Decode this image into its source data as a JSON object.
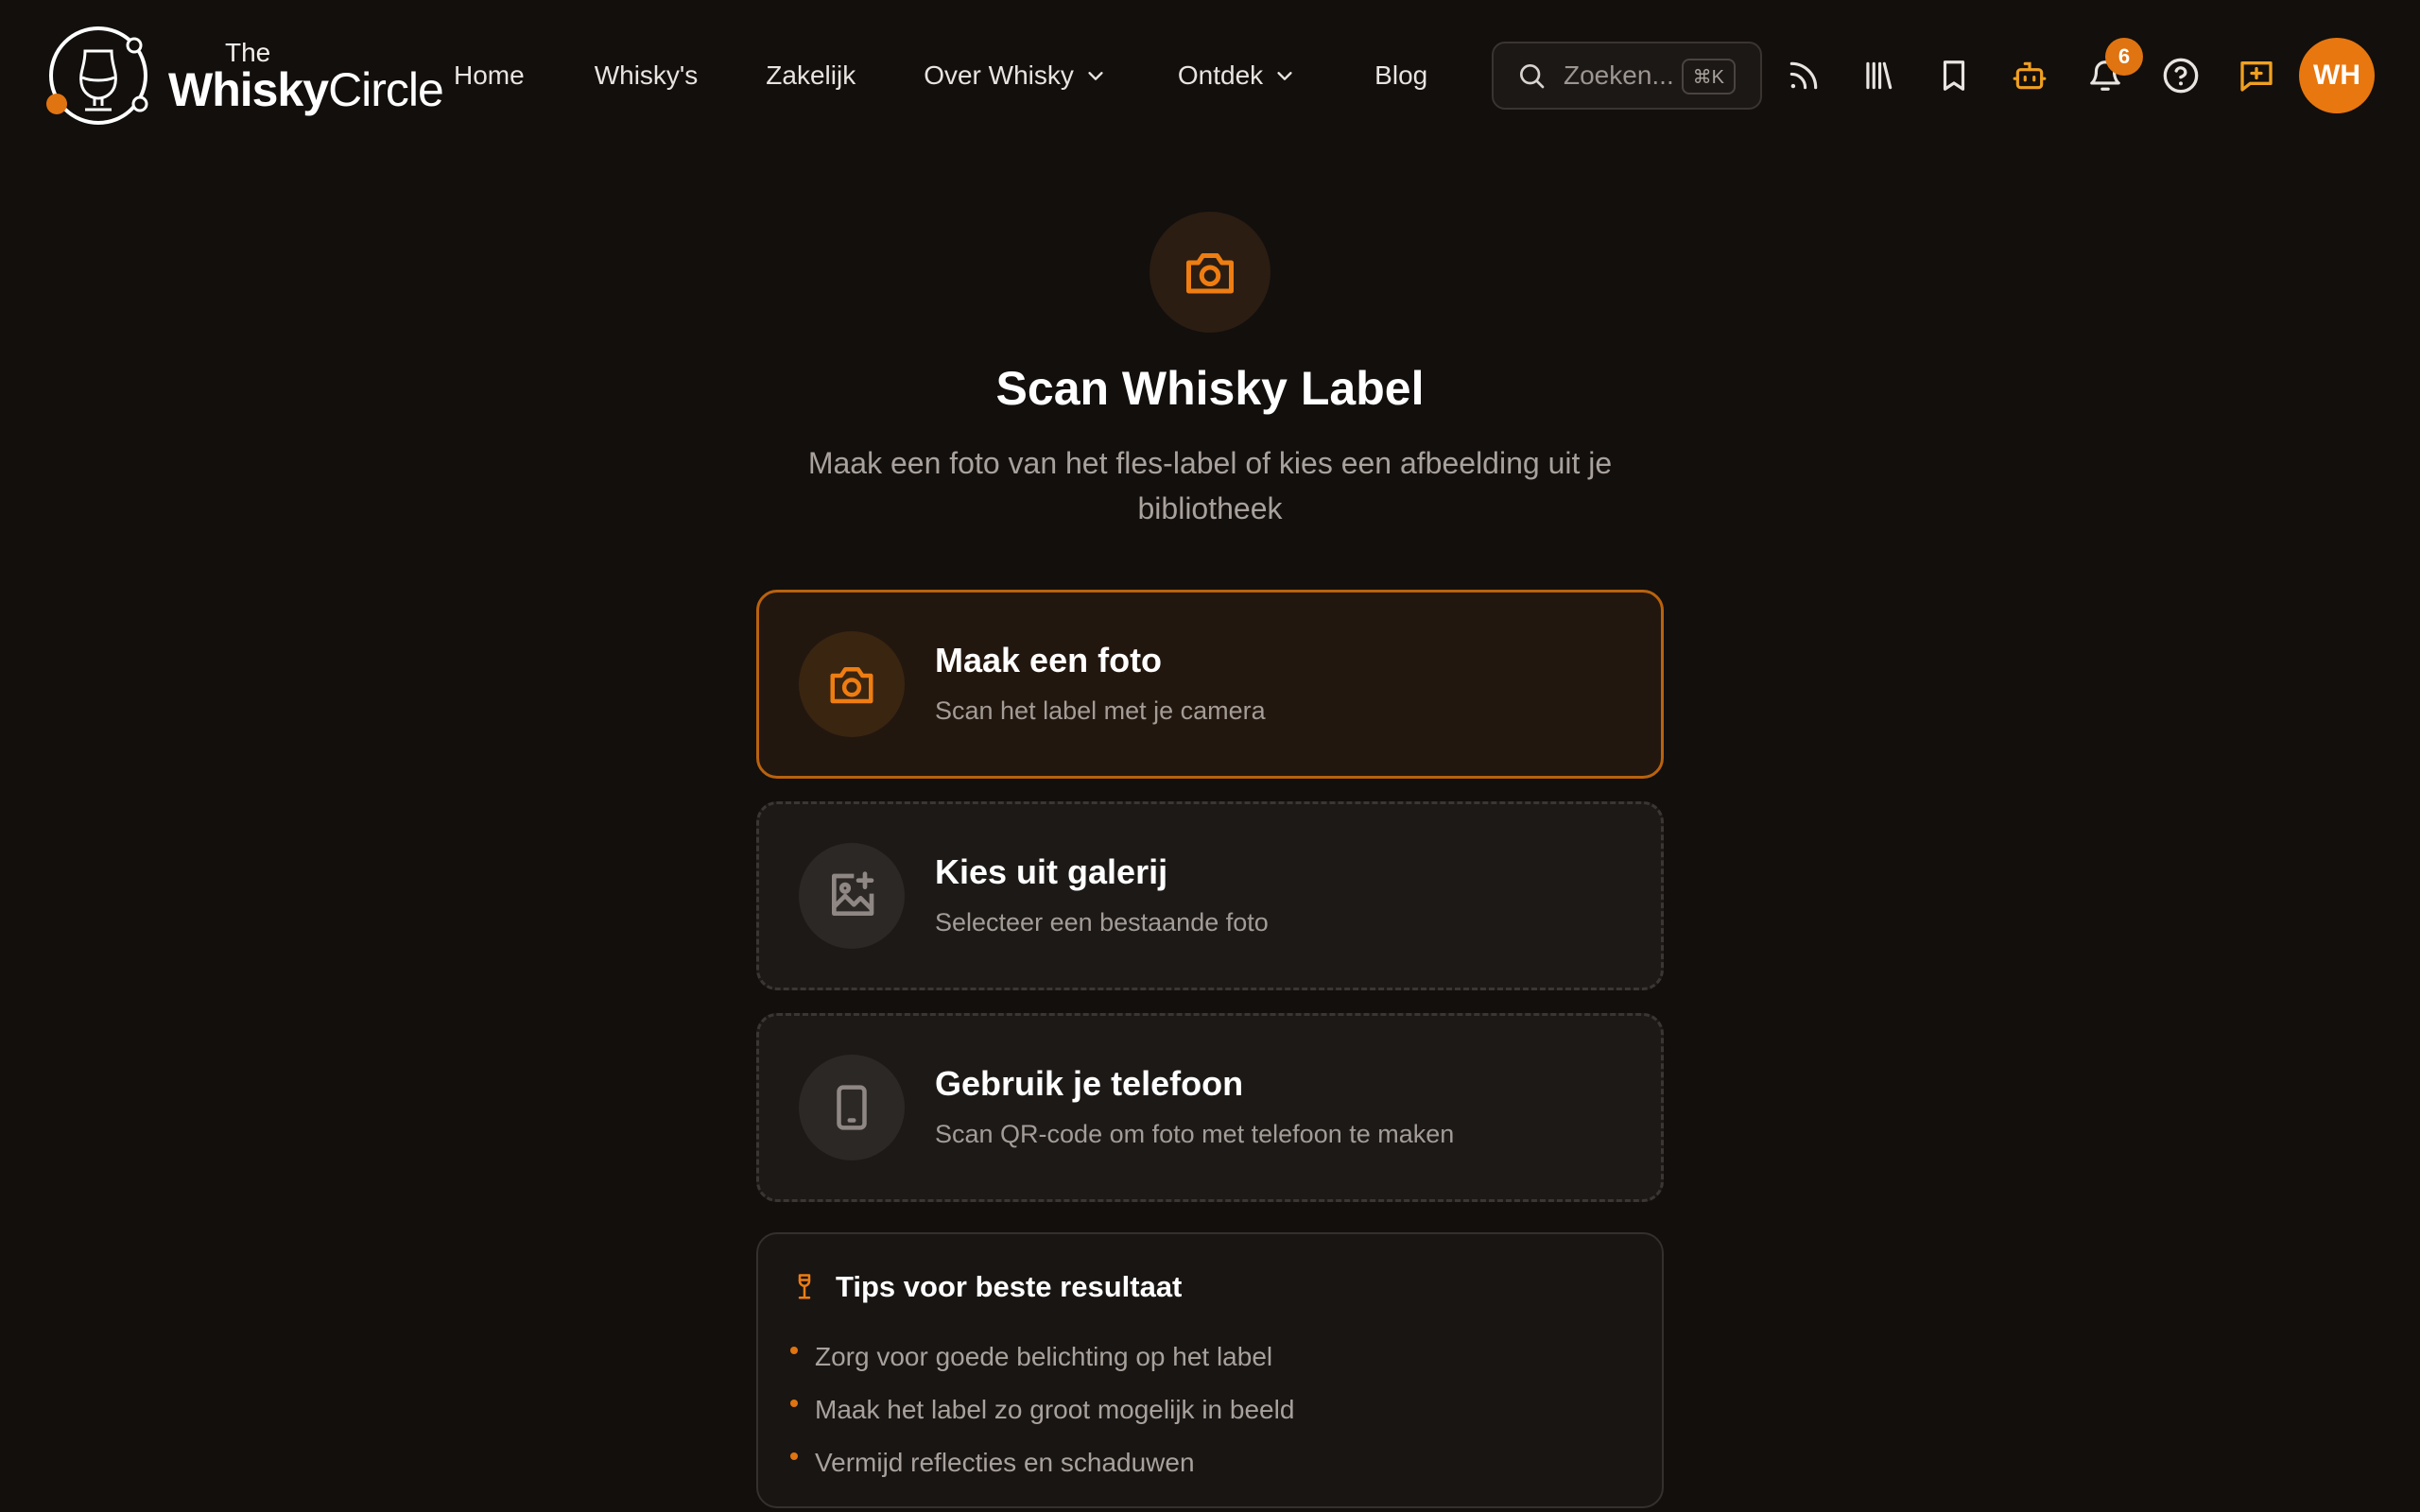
{
  "brand": {
    "the": "The",
    "name_bold": "Whisky",
    "name_regular": "Circle",
    "accent": "#e07411"
  },
  "nav": {
    "links": [
      {
        "label": "Home",
        "dropdown": false
      },
      {
        "label": "Whisky's",
        "dropdown": false
      },
      {
        "label": "Zakelijk",
        "dropdown": false
      },
      {
        "label": "Over Whisky",
        "dropdown": true
      },
      {
        "label": "Ontdek",
        "dropdown": true
      },
      {
        "label": "Blog",
        "dropdown": false
      }
    ],
    "search": {
      "placeholder": "Zoeken...",
      "shortcut": "⌘K"
    },
    "icons": [
      "rss-icon",
      "library-icon",
      "bookmark-icon",
      "bot-icon",
      "bell-icon",
      "help-icon",
      "message-plus-icon"
    ],
    "notifications_count": "6",
    "avatar_initials": "WH"
  },
  "main": {
    "title": "Scan Whisky Label",
    "subtitle": "Maak een foto van het fles-label of kies een afbeelding uit je bibliotheek",
    "options": [
      {
        "title": "Maak een foto",
        "description": "Scan het label met je camera",
        "icon": "camera-icon"
      },
      {
        "title": "Kies uit galerij",
        "description": "Selecteer een bestaande foto",
        "icon": "image-plus-icon"
      },
      {
        "title": "Gebruik je telefoon",
        "description": "Scan QR-code om foto met telefoon te maken",
        "icon": "phone-icon"
      }
    ],
    "tips": {
      "title": "Tips voor beste resultaat",
      "items": [
        "Zorg voor goede belichting op het label",
        "Maak het label zo groot mogelijk in beeld",
        "Vermijd reflecties en schaduwen"
      ]
    }
  }
}
